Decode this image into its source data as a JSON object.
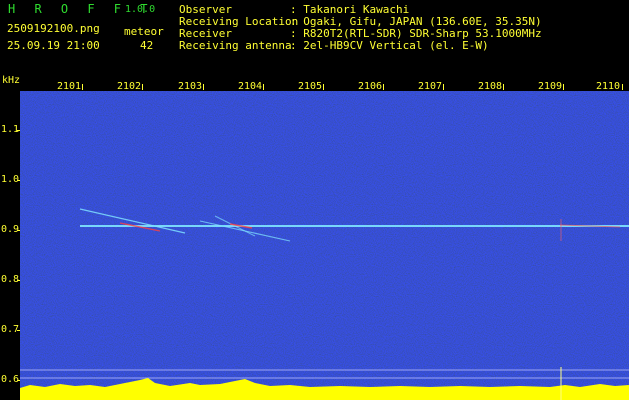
{
  "header": {
    "app_title": "H R O F F T",
    "version": "1.0.0",
    "filename": "2509192100.png",
    "datetime": "25.09.19 21:00",
    "counter_label": "meteor",
    "counter_value": "42",
    "info_labels": [
      "Observer",
      "Receiving Location",
      "Receiver",
      "Receiving antenna"
    ],
    "info_values": [
      ": Takanori Kawachi",
      ": Ogaki, Gifu, JAPAN (136.60E, 35.35N)",
      ": R820T2(RTL-SDR) SDR-Sharp 53.1000MHz",
      ": 2el-HB9CV Vertical (el. E-W)"
    ]
  },
  "axes": {
    "y_unit": "kHz",
    "y_ticks": [
      "1.1",
      "1.0",
      "0.9",
      "0.8",
      "0.7",
      "0.6"
    ],
    "x_ticks": [
      "2101",
      "2102",
      "2103",
      "2104",
      "2105",
      "2106",
      "2107",
      "2108",
      "2109",
      "2110"
    ]
  },
  "colors": {
    "background": "#000000",
    "spectrogram_base": "#0a1a8a",
    "signal": "#ff3333",
    "axis_text": "#ffff33",
    "header_green": "#2fdc2f",
    "level_bar": "#ffff00",
    "noise_floor": "#00e5ff"
  }
}
